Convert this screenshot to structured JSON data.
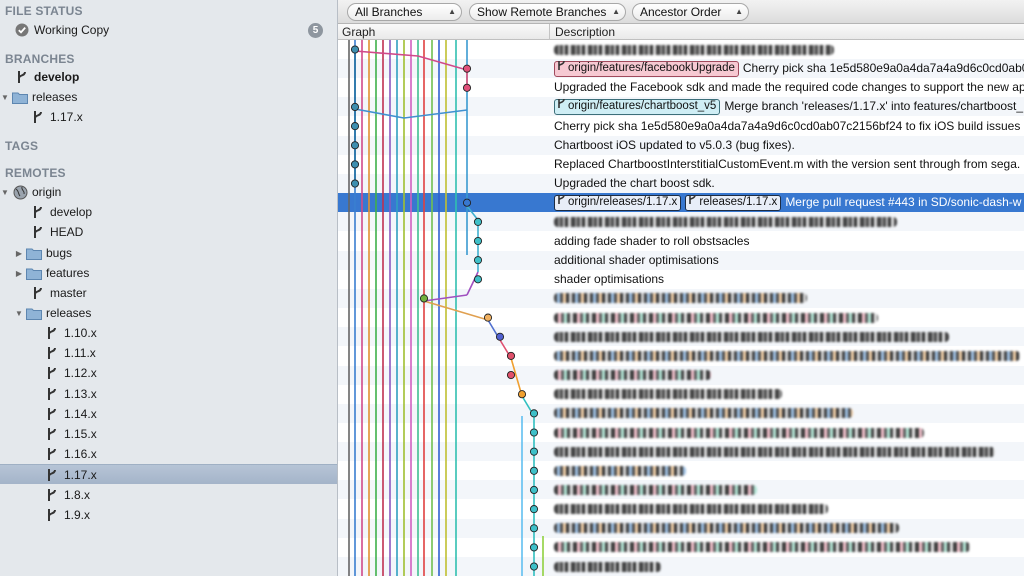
{
  "sidebar": {
    "file_status": {
      "heading": "FILE STATUS",
      "working_copy": {
        "label": "Working Copy",
        "count": "5"
      }
    },
    "branches": {
      "heading": "BRANCHES",
      "develop": "develop",
      "releases": "releases",
      "release_1_17": "1.17.x"
    },
    "tags": {
      "heading": "TAGS"
    },
    "remotes": {
      "heading": "REMOTES",
      "origin": "origin",
      "items": [
        "develop",
        "HEAD",
        "bugs",
        "features",
        "master",
        "releases"
      ],
      "releases_children": [
        "1.10.x",
        "1.11.x",
        "1.12.x",
        "1.13.x",
        "1.14.x",
        "1.15.x",
        "1.16.x",
        "1.17.x",
        "1.8.x",
        "1.9.x"
      ],
      "selected": "1.17.x"
    }
  },
  "toolbar": {
    "branches_select": "All Branches",
    "remote_select": "Show Remote Branches",
    "order_select": "Ancestor Order"
  },
  "columns": {
    "graph": "Graph",
    "description": "Description"
  },
  "commits": [
    {
      "text": "",
      "tags": []
    },
    {
      "text": "Cherry pick sha 1e5d580e9a0a4da7a4a9d6c0cd0ab0",
      "tags": [
        {
          "label": "origin/features/facebookUpgrade",
          "style": "pink"
        }
      ]
    },
    {
      "text": "Upgraded the Facebook sdk and made the required code changes to support the new ap",
      "tags": []
    },
    {
      "text": "Merge branch 'releases/1.17.x' into features/chartboost_",
      "tags": [
        {
          "label": "origin/features/chartboost_v5",
          "style": "cyan"
        }
      ]
    },
    {
      "text": "Cherry pick sha 1e5d580e9a0a4da7a4a9d6c0cd0ab07c2156bf24 to fix iOS build issues",
      "tags": []
    },
    {
      "text": "Chartboost iOS updated to v5.0.3 (bug fixes).",
      "tags": []
    },
    {
      "text": "Replaced ChartboostInterstitialCustomEvent.m with the version sent through from sega.",
      "tags": []
    },
    {
      "text": "Upgraded the chart boost sdk.",
      "tags": []
    },
    {
      "text": "Merge pull request #443 in SD/sonic-dash-w",
      "tags": [
        {
          "label": "origin/releases/1.17.x",
          "style": "white"
        },
        {
          "label": "releases/1.17.x",
          "style": "white"
        }
      ]
    },
    {
      "text": "",
      "tags": []
    },
    {
      "text": "adding fade shader to roll obstsacles",
      "tags": []
    },
    {
      "text": "additional shader optimisations",
      "tags": []
    },
    {
      "text": "shader optimisations",
      "tags": []
    }
  ],
  "colors": {
    "selection": "#3878d0",
    "sidebar_bg": "#e4e8ec",
    "node_teal": "#3ea8c0",
    "node_pink": "#e0507a"
  }
}
